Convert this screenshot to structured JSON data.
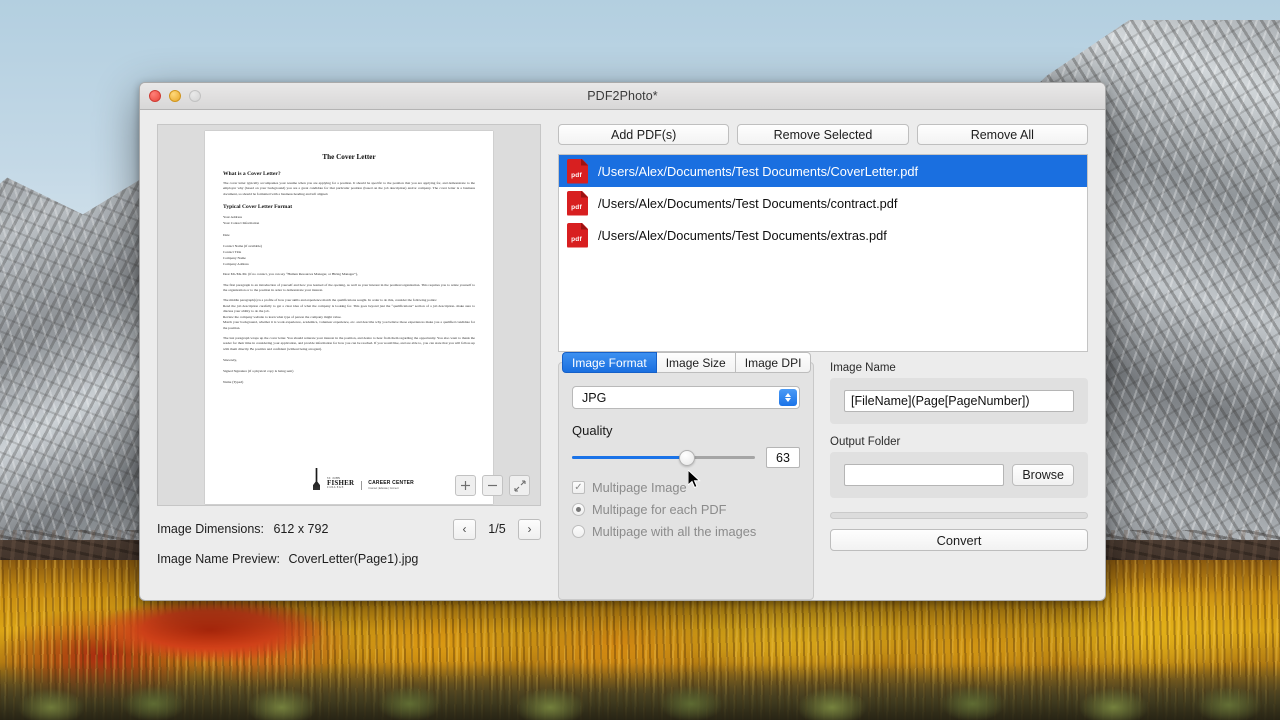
{
  "window": {
    "title": "PDF2Photo*",
    "controls": {
      "close": "close",
      "minimize": "minimize",
      "zoom": "zoom"
    }
  },
  "toolbar": {
    "add_label": "Add PDF(s)",
    "remove_selected_label": "Remove Selected",
    "remove_all_label": "Remove All"
  },
  "file_list": [
    {
      "path": "/Users/Alex/Documents/Test Documents/CoverLetter.pdf",
      "selected": true,
      "icon": "pdf-icon",
      "icon_label": "pdf"
    },
    {
      "path": "/Users/Alex/Documents/Test Documents/contract.pdf",
      "selected": false,
      "icon": "pdf-icon",
      "icon_label": "pdf"
    },
    {
      "path": "/Users/Alex/Documents/Test Documents/extras.pdf",
      "selected": false,
      "icon": "pdf-icon",
      "icon_label": "pdf"
    }
  ],
  "preview": {
    "document": {
      "title": "The Cover Letter",
      "heading1": "What is a Cover Letter?",
      "paragraph1": "The cover letter typically accompanies your resume when you are applying for a position. It should be specific to the position that you are applying for, and demonstrate to the employer why (based on your background) you are a great candidate for that particular position (based on the job description) and/or company. The cover letter is a business document, so should be formatted with a business heading and left aligned.",
      "heading2": "Typical Cover Letter Format",
      "address_block": "Your Address\nYour Contact Information",
      "date_line": "Date",
      "contact_block": "Contact Name (if available)\nContact Title\nCompany Name\nCompany Address",
      "salutation": "Dear Mr./Ms./Dr. (if no contact, you can say “Human Resources Manager, or Hiring Manager”),",
      "paragraph2": "The first paragraph is an introduction of yourself and how you learned of the opening, as well as your interest in the position/organization. This requires you to relate yourself to the organization or to the position in order to demonstrate your interest.",
      "paragraph3": "The middle paragraph(s) is a profile of how your skills and experience match the qualifications sought.  In order to do this, consider the following points:\nRead the job description carefully to get a clear idea of what the company is looking for. This goes beyond just the “qualifications” section of a job description- make sure to discuss your ability to do the job.\nReview the company website to learn what type of person the company might value.\nMatch your background, whether it is work experience, academics, volunteer experience, etc. and describe why you believe those experiences make you a qualified candidate for the position.",
      "paragraph4": "The last paragraph wraps up the cover letter. You should reiterate your interest in the position, and desire to hear from them regarding the opportunity. You also want to thank the reader for their time in considering your application, and provide information for how you can be reached. If you would like, and are able to, you can state that you will follow-up with them directly. Be positive and confident (without being arrogant).",
      "closing": "Sincerely,",
      "signature_line": "Signed Signature (if a physical copy is being sent)",
      "name_line": "Name (Typed)",
      "logo": {
        "line1": "ST. JOHN",
        "line2": "FISHER",
        "line3": "COLLEGE",
        "center_title": "CAREER CENTER",
        "center_sub": "Counsel | Educate | Connect"
      }
    },
    "zoom_in_label": "+",
    "zoom_out_label": "−",
    "fit_label": "fit"
  },
  "status": {
    "dimensions_label": "Image Dimensions:",
    "dimensions_value": "612 x 792",
    "page_indicator": "1/5",
    "prev_label": "‹",
    "next_label": "›",
    "name_preview_label": "Image Name Preview:",
    "name_preview_value": "CoverLetter(Page1).jpg"
  },
  "format_panel": {
    "tabs": [
      {
        "label": "Image Format",
        "active": true
      },
      {
        "label": "Image Size",
        "active": false
      },
      {
        "label": "Image DPI",
        "active": false
      }
    ],
    "format_value": "JPG",
    "quality_label": "Quality",
    "quality_value": "63",
    "quality_percent": 63,
    "options": [
      {
        "type": "checkbox",
        "label": "Multipage Image",
        "checked": true
      },
      {
        "type": "radio",
        "label": "Multipage for each PDF",
        "checked": true
      },
      {
        "type": "radio",
        "label": "Multipage with all the images",
        "checked": false
      }
    ]
  },
  "name_panel": {
    "image_name_label": "Image Name",
    "image_name_value": "[FileName](Page[PageNumber])",
    "output_folder_label": "Output Folder",
    "output_folder_value": "",
    "browse_label": "Browse",
    "convert_label": "Convert"
  },
  "colors": {
    "accent_blue": "#1a6fe0",
    "slider_blue": "#1a73e8",
    "pdf_red": "#d81f20",
    "window_bg": "#ececec"
  }
}
